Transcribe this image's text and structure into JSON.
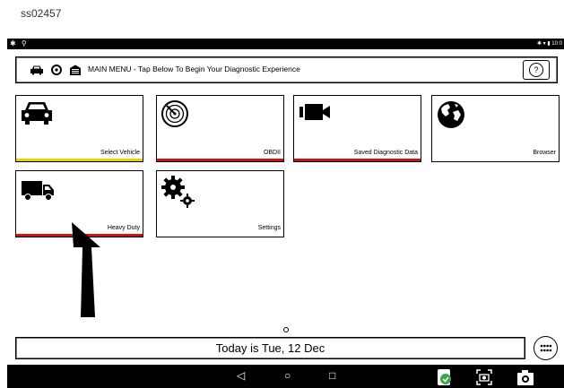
{
  "caption": "ss02457",
  "status_bar": {
    "left_icons": "✱ ⚲",
    "right_text": "✱ ▾ ▮ 10:0"
  },
  "header": {
    "title": "MAIN MENU - Tap Below To Begin Your Diagnostic Experience",
    "help_symbol": "?"
  },
  "tiles": [
    {
      "label": "Select Vehicle",
      "icon": "car-icon",
      "bar_color": "#e6d400"
    },
    {
      "label": "OBDII",
      "icon": "radar-icon",
      "bar_color": "#c81414"
    },
    {
      "label": "Saved Diagnostic Data",
      "icon": "video-camera-icon",
      "bar_color": "#c81414"
    },
    {
      "label": "Browser",
      "icon": "globe-icon",
      "bar_color": null
    },
    {
      "label": "Heavy Duty",
      "icon": "truck-icon",
      "bar_color": "#c81414"
    },
    {
      "label": "Settings",
      "icon": "gears-icon",
      "bar_color": null
    }
  ],
  "footer": {
    "date_text": "Today is Tue, 12 Dec"
  },
  "nav_bar": {
    "back": "◁",
    "home": "○",
    "recent": "□"
  }
}
